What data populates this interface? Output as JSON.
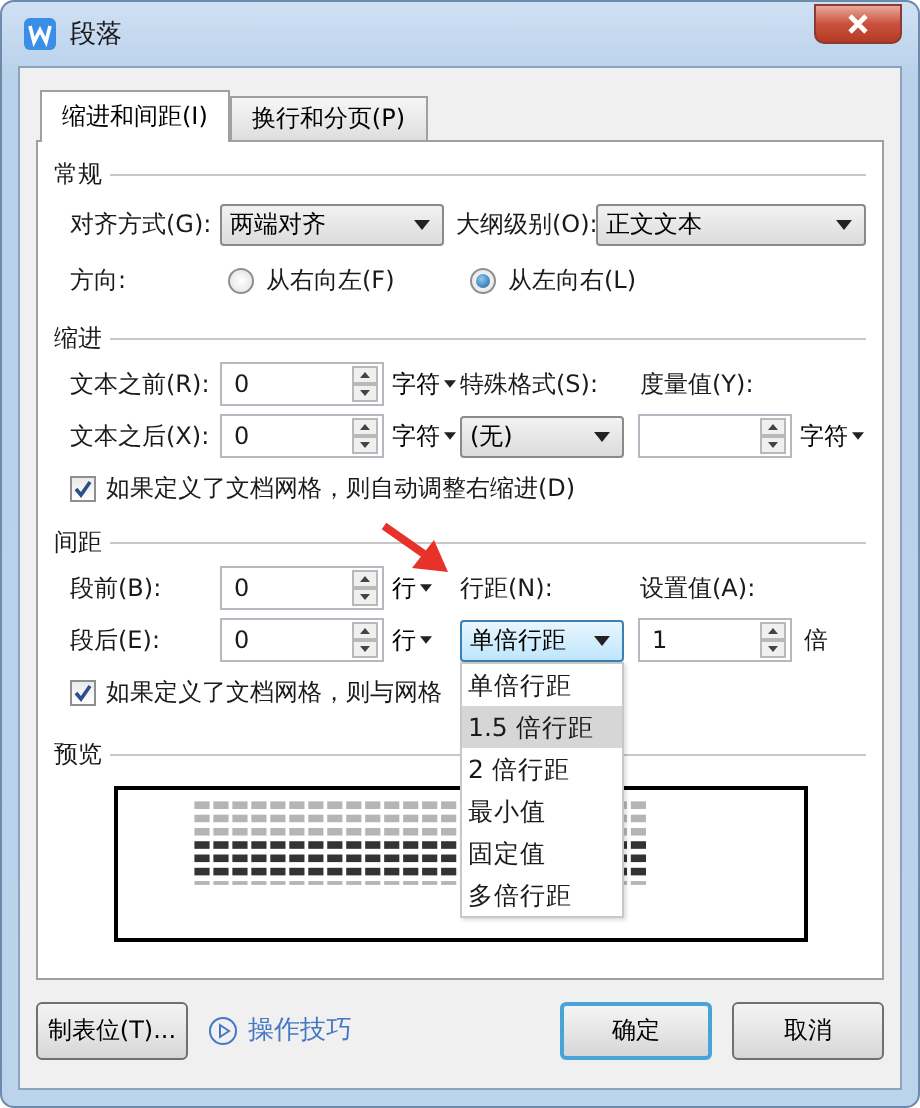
{
  "window": {
    "title": "段落"
  },
  "tabs": [
    {
      "label": "缩进和间距(I)",
      "selected": true
    },
    {
      "label": "换行和分页(P)",
      "selected": false
    }
  ],
  "general": {
    "title": "常规",
    "alignment": {
      "label": "对齐方式(G):",
      "value": "两端对齐"
    },
    "outline_level": {
      "label": "大纲级别(O):",
      "value": "正文文本"
    },
    "direction": {
      "label": "方向:",
      "options": [
        {
          "label": "从右向左(F)",
          "selected": false
        },
        {
          "label": "从左向右(L)",
          "selected": true
        }
      ]
    }
  },
  "indent": {
    "title": "缩进",
    "before": {
      "label": "文本之前(R):",
      "value": "0",
      "unit": "字符"
    },
    "after": {
      "label": "文本之后(X):",
      "value": "0",
      "unit": "字符"
    },
    "special": {
      "label": "特殊格式(S):",
      "value": "(无)"
    },
    "measure": {
      "label": "度量值(Y):",
      "unit": "字符"
    },
    "auto_adjust": {
      "label": "如果定义了文档网格，则自动调整右缩进(D)",
      "checked": true
    }
  },
  "spacing": {
    "title": "间距",
    "before": {
      "label": "段前(B):",
      "value": "0",
      "unit": "行"
    },
    "after": {
      "label": "段后(E):",
      "value": "0",
      "unit": "行"
    },
    "line_spacing": {
      "label": "行距(N):",
      "value": "单倍行距",
      "open": true,
      "options": [
        {
          "label": "单倍行距",
          "highlighted": false
        },
        {
          "label": "1.5 倍行距",
          "highlighted": true
        },
        {
          "label": "2 倍行距",
          "highlighted": false
        },
        {
          "label": "最小值",
          "highlighted": false
        },
        {
          "label": "固定值",
          "highlighted": false
        },
        {
          "label": "多倍行距",
          "highlighted": false
        }
      ]
    },
    "set_value": {
      "label": "设置值(A):",
      "value": "1",
      "unit": "倍"
    },
    "snap_grid": {
      "label": "如果定义了文档网格，则与网格",
      "checked": true
    }
  },
  "preview": {
    "title": "预览"
  },
  "footer": {
    "tab_stops": "制表位(T)...",
    "tips": "操作技巧",
    "ok": "确定",
    "cancel": "取消"
  }
}
